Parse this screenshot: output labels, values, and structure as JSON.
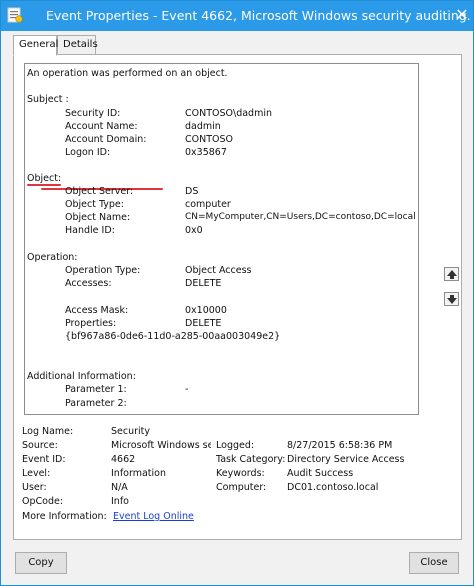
{
  "window": {
    "title": "Event Properties - Event 4662, Microsoft Windows security auditing."
  },
  "tabs": [
    {
      "label": "General",
      "active": true
    },
    {
      "label": "Details",
      "active": false
    }
  ],
  "description": {
    "intro": "An operation was performed on an object.",
    "subject": {
      "heading": "Subject :",
      "fields": [
        {
          "label": "Security ID:",
          "value": "CONTOSO\\dadmin"
        },
        {
          "label": "Account Name:",
          "value": "dadmin"
        },
        {
          "label": "Account Domain:",
          "value": "CONTOSO"
        },
        {
          "label": "Logon ID:",
          "value": "0x35867"
        }
      ]
    },
    "object": {
      "heading": "Object:",
      "fields": [
        {
          "label": "Object Server:",
          "value": "DS"
        },
        {
          "label": "Object Type:",
          "value": "computer"
        },
        {
          "label": "Object Name:",
          "value": "CN=MyComputer,CN=Users,DC=contoso,DC=local"
        },
        {
          "label": "Handle ID:",
          "value": "0x0"
        }
      ]
    },
    "operation": {
      "heading": "Operation:",
      "fields": [
        {
          "label": "Operation Type:",
          "value": "Object Access"
        },
        {
          "label": "Accesses:",
          "value": "DELETE"
        },
        {
          "label": "Access Mask:",
          "value": "0x10000"
        },
        {
          "label": "Properties:",
          "value": "DELETE"
        }
      ],
      "guid": "{bf967a86-0de6-11d0-a285-00aa003049e2}"
    },
    "additional": {
      "heading": "Additional Information:",
      "fields": [
        {
          "label": "Parameter 1:",
          "value": "-"
        },
        {
          "label": "Parameter 2:",
          "value": ""
        }
      ]
    }
  },
  "info": {
    "log_name": {
      "label": "Log Name:",
      "value": "Security"
    },
    "source": {
      "label": "Source:",
      "value": "Microsoft Windows sec"
    },
    "logged": {
      "label": "Logged:",
      "value": "8/27/2015 6:58:36 PM"
    },
    "event_id": {
      "label": "Event ID:",
      "value": "4662"
    },
    "task_category": {
      "label": "Task Category:",
      "value": "Directory Service Access"
    },
    "level": {
      "label": "Level:",
      "value": "Information"
    },
    "keywords": {
      "label": "Keywords:",
      "value": "Audit Success"
    },
    "user": {
      "label": "User:",
      "value": "N/A"
    },
    "computer": {
      "label": "Computer:",
      "value": "DC01.contoso.local"
    },
    "opcode": {
      "label": "OpCode:",
      "value": "Info"
    },
    "more_info": {
      "label": "More Information:",
      "link": "Event Log Online"
    }
  },
  "buttons": {
    "copy": "Copy",
    "close": "Close"
  },
  "colors": {
    "titlebar": "#2b9ae8",
    "annotation": "#e0353a",
    "link": "#1a3fd9"
  }
}
